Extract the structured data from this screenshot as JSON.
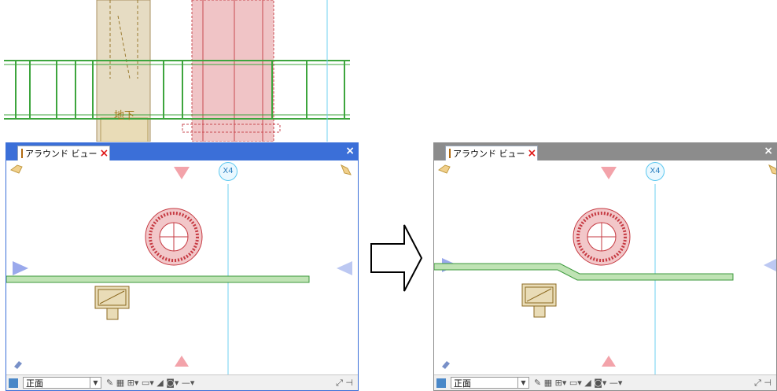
{
  "background_drawing": {
    "grid_label": "地下"
  },
  "left_panel": {
    "tab_label": "アラウンド ビュー",
    "grid_marker": "X4",
    "view_value": "正面"
  },
  "right_panel": {
    "tab_label": "アラウンド ビュー",
    "grid_marker": "X4",
    "view_value": "正面"
  },
  "colors": {
    "titlebar_active": "#3b6fd8",
    "titlebar_inactive": "#8c8c8c",
    "beam_fill": "#bfe3b4",
    "column_fill": "#e6dcc3",
    "red_column_fill": "#f0c4c6",
    "grid_line": "#6fd0f0"
  }
}
